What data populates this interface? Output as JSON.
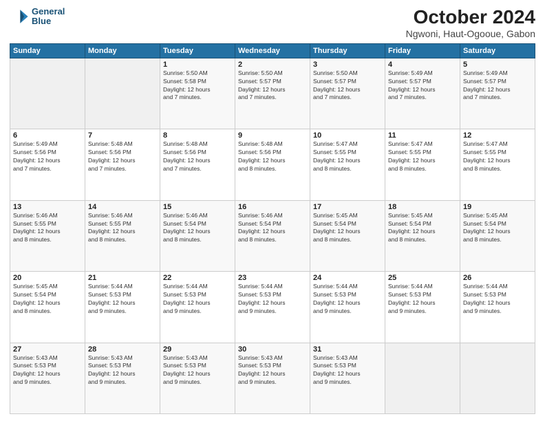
{
  "logo": {
    "line1": "General",
    "line2": "Blue"
  },
  "title": "October 2024",
  "subtitle": "Ngwoni, Haut-Ogooue, Gabon",
  "days_of_week": [
    "Sunday",
    "Monday",
    "Tuesday",
    "Wednesday",
    "Thursday",
    "Friday",
    "Saturday"
  ],
  "weeks": [
    [
      {
        "day": "",
        "info": ""
      },
      {
        "day": "",
        "info": ""
      },
      {
        "day": "1",
        "info": "Sunrise: 5:50 AM\nSunset: 5:58 PM\nDaylight: 12 hours\nand 7 minutes."
      },
      {
        "day": "2",
        "info": "Sunrise: 5:50 AM\nSunset: 5:57 PM\nDaylight: 12 hours\nand 7 minutes."
      },
      {
        "day": "3",
        "info": "Sunrise: 5:50 AM\nSunset: 5:57 PM\nDaylight: 12 hours\nand 7 minutes."
      },
      {
        "day": "4",
        "info": "Sunrise: 5:49 AM\nSunset: 5:57 PM\nDaylight: 12 hours\nand 7 minutes."
      },
      {
        "day": "5",
        "info": "Sunrise: 5:49 AM\nSunset: 5:57 PM\nDaylight: 12 hours\nand 7 minutes."
      }
    ],
    [
      {
        "day": "6",
        "info": "Sunrise: 5:49 AM\nSunset: 5:56 PM\nDaylight: 12 hours\nand 7 minutes."
      },
      {
        "day": "7",
        "info": "Sunrise: 5:48 AM\nSunset: 5:56 PM\nDaylight: 12 hours\nand 7 minutes."
      },
      {
        "day": "8",
        "info": "Sunrise: 5:48 AM\nSunset: 5:56 PM\nDaylight: 12 hours\nand 7 minutes."
      },
      {
        "day": "9",
        "info": "Sunrise: 5:48 AM\nSunset: 5:56 PM\nDaylight: 12 hours\nand 8 minutes."
      },
      {
        "day": "10",
        "info": "Sunrise: 5:47 AM\nSunset: 5:55 PM\nDaylight: 12 hours\nand 8 minutes."
      },
      {
        "day": "11",
        "info": "Sunrise: 5:47 AM\nSunset: 5:55 PM\nDaylight: 12 hours\nand 8 minutes."
      },
      {
        "day": "12",
        "info": "Sunrise: 5:47 AM\nSunset: 5:55 PM\nDaylight: 12 hours\nand 8 minutes."
      }
    ],
    [
      {
        "day": "13",
        "info": "Sunrise: 5:46 AM\nSunset: 5:55 PM\nDaylight: 12 hours\nand 8 minutes."
      },
      {
        "day": "14",
        "info": "Sunrise: 5:46 AM\nSunset: 5:55 PM\nDaylight: 12 hours\nand 8 minutes."
      },
      {
        "day": "15",
        "info": "Sunrise: 5:46 AM\nSunset: 5:54 PM\nDaylight: 12 hours\nand 8 minutes."
      },
      {
        "day": "16",
        "info": "Sunrise: 5:46 AM\nSunset: 5:54 PM\nDaylight: 12 hours\nand 8 minutes."
      },
      {
        "day": "17",
        "info": "Sunrise: 5:45 AM\nSunset: 5:54 PM\nDaylight: 12 hours\nand 8 minutes."
      },
      {
        "day": "18",
        "info": "Sunrise: 5:45 AM\nSunset: 5:54 PM\nDaylight: 12 hours\nand 8 minutes."
      },
      {
        "day": "19",
        "info": "Sunrise: 5:45 AM\nSunset: 5:54 PM\nDaylight: 12 hours\nand 8 minutes."
      }
    ],
    [
      {
        "day": "20",
        "info": "Sunrise: 5:45 AM\nSunset: 5:54 PM\nDaylight: 12 hours\nand 8 minutes."
      },
      {
        "day": "21",
        "info": "Sunrise: 5:44 AM\nSunset: 5:53 PM\nDaylight: 12 hours\nand 9 minutes."
      },
      {
        "day": "22",
        "info": "Sunrise: 5:44 AM\nSunset: 5:53 PM\nDaylight: 12 hours\nand 9 minutes."
      },
      {
        "day": "23",
        "info": "Sunrise: 5:44 AM\nSunset: 5:53 PM\nDaylight: 12 hours\nand 9 minutes."
      },
      {
        "day": "24",
        "info": "Sunrise: 5:44 AM\nSunset: 5:53 PM\nDaylight: 12 hours\nand 9 minutes."
      },
      {
        "day": "25",
        "info": "Sunrise: 5:44 AM\nSunset: 5:53 PM\nDaylight: 12 hours\nand 9 minutes."
      },
      {
        "day": "26",
        "info": "Sunrise: 5:44 AM\nSunset: 5:53 PM\nDaylight: 12 hours\nand 9 minutes."
      }
    ],
    [
      {
        "day": "27",
        "info": "Sunrise: 5:43 AM\nSunset: 5:53 PM\nDaylight: 12 hours\nand 9 minutes."
      },
      {
        "day": "28",
        "info": "Sunrise: 5:43 AM\nSunset: 5:53 PM\nDaylight: 12 hours\nand 9 minutes."
      },
      {
        "day": "29",
        "info": "Sunrise: 5:43 AM\nSunset: 5:53 PM\nDaylight: 12 hours\nand 9 minutes."
      },
      {
        "day": "30",
        "info": "Sunrise: 5:43 AM\nSunset: 5:53 PM\nDaylight: 12 hours\nand 9 minutes."
      },
      {
        "day": "31",
        "info": "Sunrise: 5:43 AM\nSunset: 5:53 PM\nDaylight: 12 hours\nand 9 minutes."
      },
      {
        "day": "",
        "info": ""
      },
      {
        "day": "",
        "info": ""
      }
    ]
  ]
}
